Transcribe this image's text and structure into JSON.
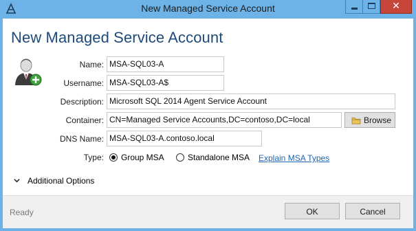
{
  "window": {
    "title": "New Managed Service Account",
    "minimize_icon": "minimize-icon",
    "maximize_icon": "maximize-icon",
    "close_glyph": "✕"
  },
  "page": {
    "heading": "New Managed Service Account"
  },
  "form": {
    "name_label": "Name:",
    "name_value": "MSA-SQL03-A",
    "username_label": "Username:",
    "username_value": "MSA-SQL03-A$",
    "description_label": "Description:",
    "description_value": "Microsoft SQL 2014 Agent Service Account",
    "container_label": "Container:",
    "container_value": "CN=Managed Service Accounts,DC=contoso,DC=local",
    "browse_label": "Browse",
    "dns_label": "DNS Name:",
    "dns_value": "MSA-SQL03-A.contoso.local",
    "type_label": "Type:",
    "type_options": [
      "Group MSA",
      "Standalone MSA"
    ],
    "type_selected": "Group MSA",
    "explain_link": "Explain MSA Types"
  },
  "additional_options": {
    "label": "Additional Options",
    "expanded": false
  },
  "footer": {
    "status": "Ready",
    "ok_label": "OK",
    "cancel_label": "Cancel"
  },
  "colors": {
    "titlebar": "#6db3e8",
    "close_button": "#c7463b",
    "heading": "#1e4a7b",
    "link": "#1a64b4"
  }
}
